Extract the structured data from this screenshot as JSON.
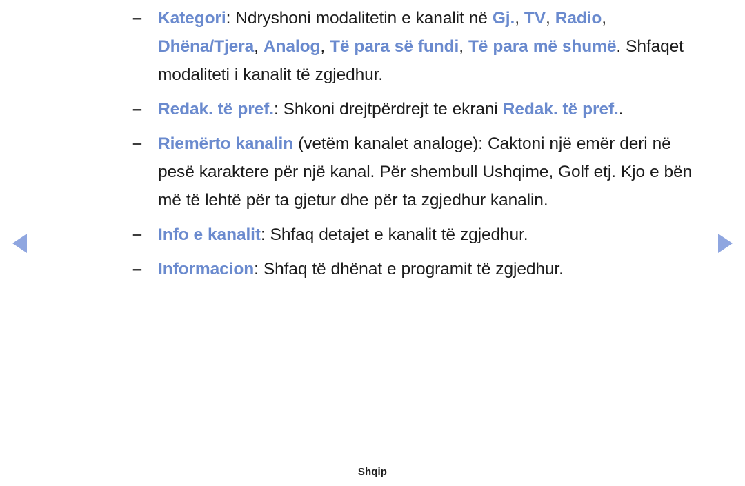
{
  "nav": {
    "prev_icon": "triangle-left-icon",
    "next_icon": "triangle-right-icon",
    "arrow_color": "#8fa6e0"
  },
  "colors": {
    "term_blue": "#6a8ace",
    "body_text": "#1c1c1c",
    "dash": "#3c3c3c"
  },
  "bullet_marker": "–",
  "items": [
    {
      "id": "kategori",
      "term": "Kategori",
      "segments": [
        {
          "text": "Kategori",
          "style": "term"
        },
        {
          "text": ": Ndryshoni modalitetin e kanalit në ",
          "style": "plain"
        },
        {
          "text": "Gj.",
          "style": "term"
        },
        {
          "text": ", ",
          "style": "plain"
        },
        {
          "text": "TV",
          "style": "term"
        },
        {
          "text": ", ",
          "style": "plain"
        },
        {
          "text": "Radio",
          "style": "term"
        },
        {
          "text": ", ",
          "style": "plain"
        },
        {
          "text": "Dhëna/",
          "style": "term"
        },
        {
          "text": "Tjera",
          "style": "term"
        },
        {
          "text": ", ",
          "style": "plain"
        },
        {
          "text": "Analog",
          "style": "term"
        },
        {
          "text": ", ",
          "style": "plain"
        },
        {
          "text": "Të para së fundi",
          "style": "term"
        },
        {
          "text": ", ",
          "style": "plain"
        },
        {
          "text": "Të para më shumë",
          "style": "term"
        },
        {
          "text": ". Shfaqet modaliteti i kanalit të zgjedhur.",
          "style": "plain"
        }
      ]
    },
    {
      "id": "redak",
      "term": "Redak. të pref.",
      "segments": [
        {
          "text": "Redak. të pref.",
          "style": "term"
        },
        {
          "text": ": Shkoni drejtpërdrejt te ekrani ",
          "style": "plain"
        },
        {
          "text": "Redak. të pref.",
          "style": "term"
        },
        {
          "text": ".",
          "style": "plain"
        }
      ]
    },
    {
      "id": "riemerto",
      "term": "Riemërto kanalin",
      "segments": [
        {
          "text": "Riemërto kanalin",
          "style": "term"
        },
        {
          "text": " (vetëm kanalet analoge): Caktoni një emër deri në pesë karaktere për një kanal. Për shembull Ushqime, Golf etj. Kjo e bën më të lehtë për ta gjetur dhe për ta zgjedhur kanalin.",
          "style": "plain"
        }
      ]
    },
    {
      "id": "info",
      "term": "Info e kanalit",
      "segments": [
        {
          "text": "Info e kanalit",
          "style": "term"
        },
        {
          "text": ": Shfaq detajet e kanalit të zgjedhur.",
          "style": "plain"
        }
      ]
    },
    {
      "id": "informacion",
      "term": "Informacion",
      "segments": [
        {
          "text": "Informacion",
          "style": "term"
        },
        {
          "text": ": Shfaq të dhënat e programit të zgjedhur.",
          "style": "plain"
        }
      ]
    }
  ],
  "footer": {
    "language": "Shqip"
  }
}
